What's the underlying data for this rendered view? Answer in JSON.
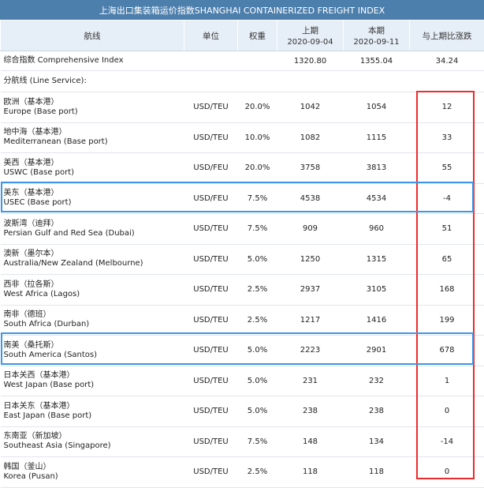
{
  "title": "上海出口集装箱运价指数SHANGHAI CONTAINERIZED FREIGHT INDEX",
  "headers": {
    "route": "航线",
    "unit": "单位",
    "weight": "权重",
    "prev_label": "上期",
    "prev_date": "2020-09-04",
    "curr_label": "本期",
    "curr_date": "2020-09-11",
    "change": "与上期比涨跌"
  },
  "composite": {
    "name": "综合指数 Comprehensive Index",
    "prev": "1320.80",
    "curr": "1355.04",
    "change": "34.24"
  },
  "section_label": "分航线 (Line Service):",
  "rows": [
    {
      "cn": "欧洲（基本港）",
      "en": "Europe (Base port)",
      "unit": "USD/TEU",
      "weight": "20.0%",
      "prev": "1042",
      "curr": "1054",
      "change": "12"
    },
    {
      "cn": "地中海（基本港）",
      "en": "Mediterranean (Base port)",
      "unit": "USD/TEU",
      "weight": "10.0%",
      "prev": "1082",
      "curr": "1115",
      "change": "33"
    },
    {
      "cn": "美西（基本港）",
      "en": "USWC (Base port)",
      "unit": "USD/FEU",
      "weight": "20.0%",
      "prev": "3758",
      "curr": "3813",
      "change": "55"
    },
    {
      "cn": "美东（基本港）",
      "en": "USEC (Base port)",
      "unit": "USD/FEU",
      "weight": "7.5%",
      "prev": "4538",
      "curr": "4534",
      "change": "-4"
    },
    {
      "cn": "波斯湾（迪拜）",
      "en": "Persian Gulf and Red Sea (Dubai)",
      "unit": "USD/TEU",
      "weight": "7.5%",
      "prev": "909",
      "curr": "960",
      "change": "51"
    },
    {
      "cn": "澳新（墨尔本）",
      "en": "Australia/New Zealand (Melbourne)",
      "unit": "USD/TEU",
      "weight": "5.0%",
      "prev": "1250",
      "curr": "1315",
      "change": "65"
    },
    {
      "cn": "西非（拉各斯）",
      "en": "West Africa (Lagos)",
      "unit": "USD/TEU",
      "weight": "2.5%",
      "prev": "2937",
      "curr": "3105",
      "change": "168"
    },
    {
      "cn": "南非（德班）",
      "en": "South Africa (Durban)",
      "unit": "USD/TEU",
      "weight": "2.5%",
      "prev": "1217",
      "curr": "1416",
      "change": "199"
    },
    {
      "cn": "南美（桑托斯）",
      "en": "South America (Santos)",
      "unit": "USD/TEU",
      "weight": "5.0%",
      "prev": "2223",
      "curr": "2901",
      "change": "678"
    },
    {
      "cn": "日本关西（基本港）",
      "en": "West Japan (Base port)",
      "unit": "USD/TEU",
      "weight": "5.0%",
      "prev": "231",
      "curr": "232",
      "change": "1"
    },
    {
      "cn": "日本关东（基本港）",
      "en": "East Japan (Base port)",
      "unit": "USD/TEU",
      "weight": "5.0%",
      "prev": "238",
      "curr": "238",
      "change": "0"
    },
    {
      "cn": "东南亚（新加坡）",
      "en": "Southeast Asia (Singapore)",
      "unit": "USD/TEU",
      "weight": "7.5%",
      "prev": "148",
      "curr": "134",
      "change": "-14"
    },
    {
      "cn": "韩国（釜山）",
      "en": "Korea (Pusan)",
      "unit": "USD/TEU",
      "weight": "2.5%",
      "prev": "118",
      "curr": "118",
      "change": "0"
    }
  ],
  "colors": {
    "title_bg": "#4d7fad",
    "header_bg": "#e6eef7",
    "highlight_red": "#ef2b2b",
    "highlight_blue": "#3f95e6"
  }
}
